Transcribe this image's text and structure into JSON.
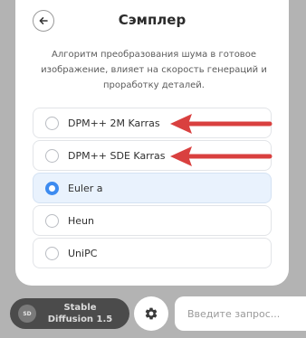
{
  "modal": {
    "title": "Сэмплер",
    "description": "Алгоритм преобразования шума в готовое изображение, влияет на скорость генераций и проработку деталей.",
    "options": [
      {
        "label": "DPM++ 2M Karras",
        "selected": false
      },
      {
        "label": "DPM++ SDE Karras",
        "selected": false
      },
      {
        "label": "Euler a",
        "selected": true
      },
      {
        "label": "Heun",
        "selected": false
      },
      {
        "label": "UniPC",
        "selected": false
      }
    ]
  },
  "bottom_bar": {
    "model_name_line1": "Stable",
    "model_name_line2": "Diffusion 1.5",
    "model_logo_text": "SD",
    "settings_icon": "gear-icon",
    "prompt_placeholder": "Введите запрос..."
  },
  "colors": {
    "accent": "#3d8bf0",
    "selected_bg": "#e9f2fd",
    "arrow": "#d9403f",
    "overlay": "#b3b3b3"
  }
}
